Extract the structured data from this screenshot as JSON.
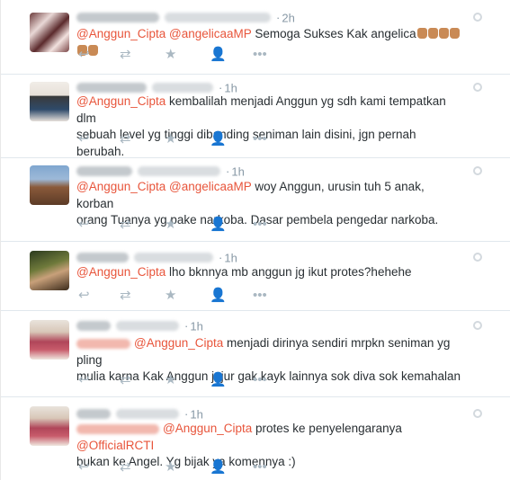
{
  "tweets": [
    {
      "time": "2h",
      "recipients": [],
      "mentions": [
        "@Anggun_Cipta",
        "@angelicaaMP"
      ],
      "text": " Semoga Sukses Kak angelica",
      "line2": "",
      "emoji_count": 6
    },
    {
      "time": "1h",
      "recipients": [],
      "mentions": [
        "@Anggun_Cipta"
      ],
      "text": " kembalilah menjadi Anggun yg sdh kami tempatkan dlm",
      "line2": "sebuah level yg tinggi dibanding seniman lain disini, jgn pernah berubah.",
      "emoji_count": 0
    },
    {
      "time": "1h",
      "recipients": [],
      "mentions": [
        "@Anggun_Cipta",
        "@angelicaaMP"
      ],
      "text": " woy Anggun, urusin tuh 5 anak, korban",
      "line2": "orang Tuanya yg pake narkoba. Dasar pembela pengedar narkoba.",
      "emoji_count": 0
    },
    {
      "time": "1h",
      "recipients": [],
      "mentions": [
        "@Anggun_Cipta"
      ],
      "text": " lho bknnya mb anggun jg ikut protes?hehehe",
      "line2": "",
      "emoji_count": 0
    },
    {
      "time": "1h",
      "recipients": [
        "hidden"
      ],
      "mentions": [
        "@Anggun_Cipta"
      ],
      "text": " menjadi dirinya sendiri mrpkn seniman yg pling",
      "line2": "mulia karna Kak Anggun jujur gak kayk lainnya sok diva sok kemahalan",
      "emoji_count": 0
    },
    {
      "time": "1h",
      "recipients": [
        "hidden"
      ],
      "mentions": [
        "@Anggun_Cipta"
      ],
      "text": " protes ke penyelengaranya ",
      "mention_end": "@OfficialRCTI",
      "line2": "bukan ke Angel. Yg bijak ya komennya :)",
      "emoji_count": 0
    }
  ],
  "icons": {
    "reply": "reply-icon",
    "retweet": "retweet-icon",
    "favorite": "star-icon",
    "follow": "follow-icon",
    "more": "more-icon",
    "settings": "gear-icon"
  },
  "colors": {
    "mention": "#e8553b",
    "action": "#aab8c2",
    "text": "#292f33",
    "time": "#8899a6"
  }
}
